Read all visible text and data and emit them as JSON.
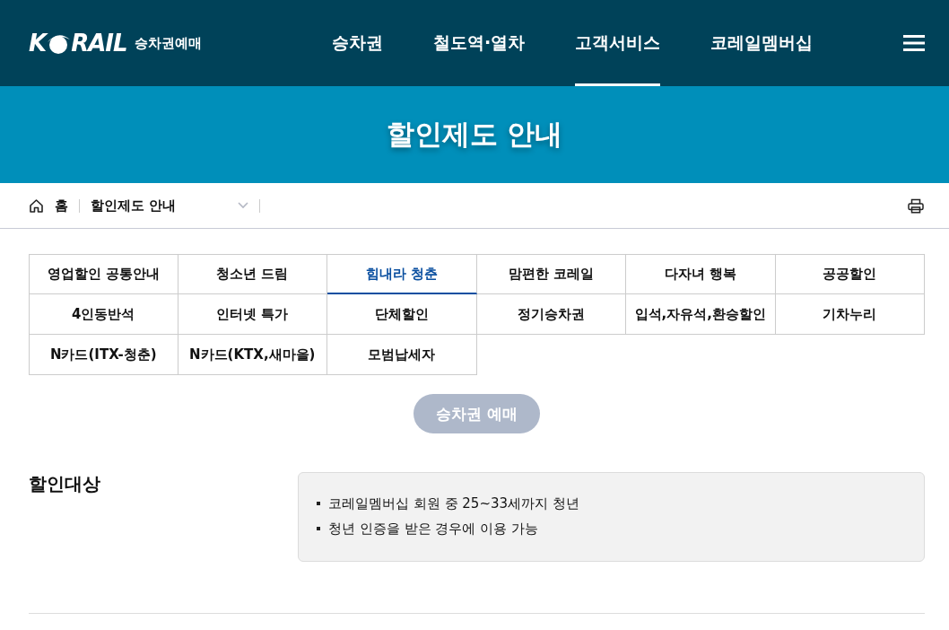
{
  "header": {
    "logo": {
      "before": "K",
      "after": "RAIL",
      "subtitle": "승차권예매"
    },
    "nav": [
      {
        "label": "승차권",
        "selected": false
      },
      {
        "label": "철도역·열차",
        "selected": false
      },
      {
        "label": "고객서비스",
        "selected": true
      },
      {
        "label": "코레일멤버십",
        "selected": false
      }
    ]
  },
  "banner": {
    "title": "할인제도 안내"
  },
  "breadcrumb": {
    "home": "홈",
    "current": "할인제도 안내"
  },
  "tabs": [
    {
      "label": "영업할인 공통안내",
      "selected": false
    },
    {
      "label": "청소년 드림",
      "selected": false
    },
    {
      "label": "힘내라 청춘",
      "selected": true
    },
    {
      "label": "맘편한 코레일",
      "selected": false
    },
    {
      "label": "다자녀 행복",
      "selected": false
    },
    {
      "label": "공공할인",
      "selected": false
    },
    {
      "label": "4인동반석",
      "selected": false
    },
    {
      "label": "인터넷 특가",
      "selected": false
    },
    {
      "label": "단체할인",
      "selected": false
    },
    {
      "label": "정기승차권",
      "selected": false
    },
    {
      "label": "입석,자유석,환승할인",
      "selected": false
    },
    {
      "label": "기차누리",
      "selected": false
    },
    {
      "label": "N카드(ITX-청춘)",
      "selected": false
    },
    {
      "label": "N카드(KTX,새마을)",
      "selected": false
    },
    {
      "label": "모범납세자",
      "selected": false
    }
  ],
  "reserve_button": {
    "label": "승차권 예매",
    "disabled": true
  },
  "sections": [
    {
      "heading": "할인대상",
      "items": [
        "코레일멤버십 회원 중 25~33세까지 청년",
        "청년 인증을 받은 경우에 이용 가능"
      ]
    }
  ]
}
